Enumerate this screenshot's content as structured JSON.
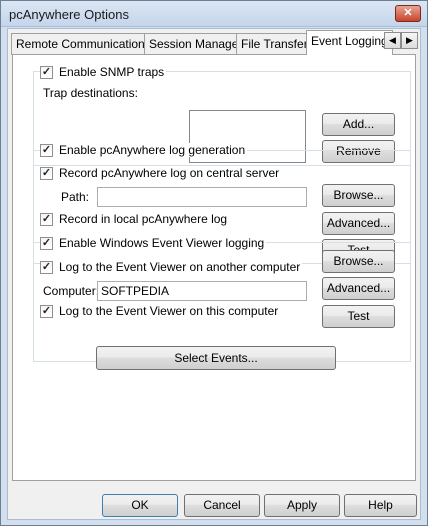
{
  "window": {
    "title": "pcAnywhere Options",
    "close_glyph": "✕"
  },
  "tabs": [
    {
      "label": "Remote Communications"
    },
    {
      "label": "Session Manager"
    },
    {
      "label": "File Transfer"
    },
    {
      "label": "Event Logging",
      "active": true
    }
  ],
  "tab_arrows": {
    "left": "◀",
    "right": "▶"
  },
  "check_glyph": "✓",
  "snmp": {
    "enable_label": "Enable SNMP traps",
    "enable_checked": true,
    "destinations_label": "Trap destinations:",
    "add_button": "Add...",
    "remove_button": "Remove"
  },
  "log": {
    "enable_label": "Enable pcAnywhere log generation",
    "enable_checked": true,
    "central_label": "Record pcAnywhere log on central server",
    "central_checked": true,
    "path_label": "Path:",
    "path_value": "",
    "local_label": "Record in local pcAnywhere log",
    "local_checked": true,
    "browse_button": "Browse...",
    "advanced_button": "Advanced...",
    "test_button": "Test"
  },
  "eventviewer": {
    "enable_label": "Enable Windows Event Viewer logging",
    "enable_checked": true,
    "another_label": "Log to the Event Viewer on another computer",
    "another_checked": true,
    "computer_label": "Computer:",
    "computer_value": "SOFTPEDIA",
    "this_label": "Log to the Event Viewer on this computer",
    "this_checked": true,
    "browse_button": "Browse...",
    "advanced_button": "Advanced...",
    "test_button": "Test"
  },
  "select_events_button": "Select Events...",
  "footer": {
    "ok": "OK",
    "cancel": "Cancel",
    "apply": "Apply",
    "help": "Help"
  }
}
